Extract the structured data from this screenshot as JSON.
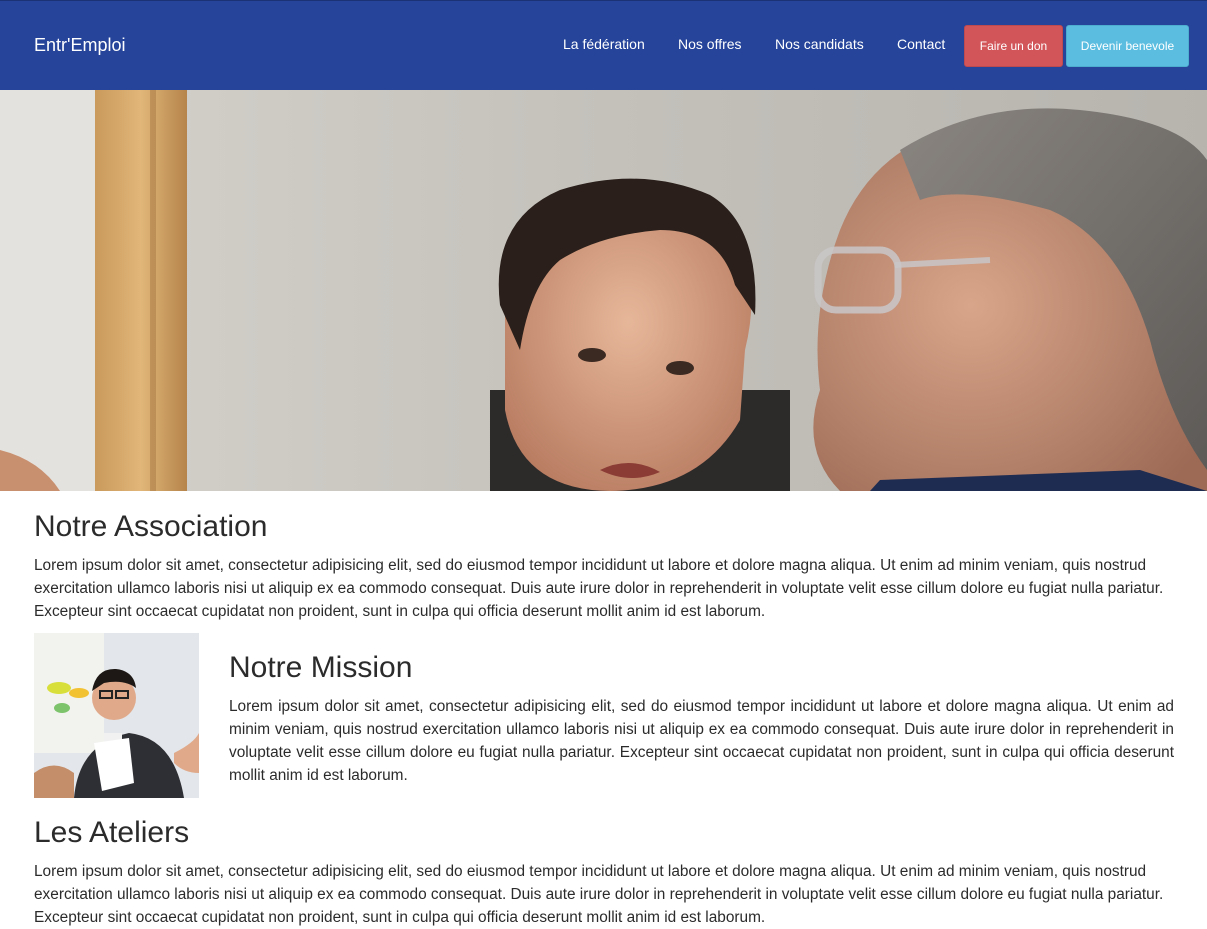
{
  "navbar": {
    "brand": "Entr'Emploi",
    "links": [
      {
        "label": "La fédération"
      },
      {
        "label": "Nos offres"
      },
      {
        "label": "Nos candidats"
      },
      {
        "label": "Contact"
      }
    ],
    "donate_label": "Faire un don",
    "volunteer_label": "Devenir benevole"
  },
  "colors": {
    "navbar": "#25449a",
    "donate_button": "#d2555a",
    "volunteer_button": "#5bbde0",
    "text": "#2b2b2b"
  },
  "sections": {
    "association": {
      "title": "Notre Association",
      "text": "Lorem ipsum dolor sit amet, consectetur adipisicing elit, sed do eiusmod tempor incididunt ut labore et dolore magna aliqua. Ut enim ad minim veniam, quis nostrud exercitation ullamco laboris nisi ut aliquip ex ea commodo consequat. Duis aute irure dolor in reprehenderit in voluptate velit esse cillum dolore eu fugiat nulla pariatur. Excepteur sint occaecat cupidatat non proident, sunt in culpa qui officia deserunt mollit anim id est laborum."
    },
    "mission": {
      "title": "Notre Mission",
      "text": "Lorem ipsum dolor sit amet, consectetur adipisicing elit, sed do eiusmod tempor incididunt ut labore et dolore magna aliqua. Ut enim ad minim veniam, quis nostrud exercitation ullamco laboris nisi ut aliquip ex ea commodo consequat. Duis aute irure dolor in reprehenderit in voluptate velit esse cillum dolore eu fugiat nulla pariatur. Excepteur sint occaecat cupidatat non proident, sunt in culpa qui officia deserunt mollit anim id est laborum."
    },
    "ateliers": {
      "title": "Les Ateliers",
      "text": "Lorem ipsum dolor sit amet, consectetur adipisicing elit, sed do eiusmod tempor incididunt ut labore et dolore magna aliqua. Ut enim ad minim veniam, quis nostrud exercitation ullamco laboris nisi ut aliquip ex ea commodo consequat. Duis aute irure dolor in reprehenderit in voluptate velit esse cillum dolore eu fugiat nulla pariatur. Excepteur sint occaecat cupidatat non proident, sunt in culpa qui officia deserunt mollit anim id est laborum."
    }
  }
}
